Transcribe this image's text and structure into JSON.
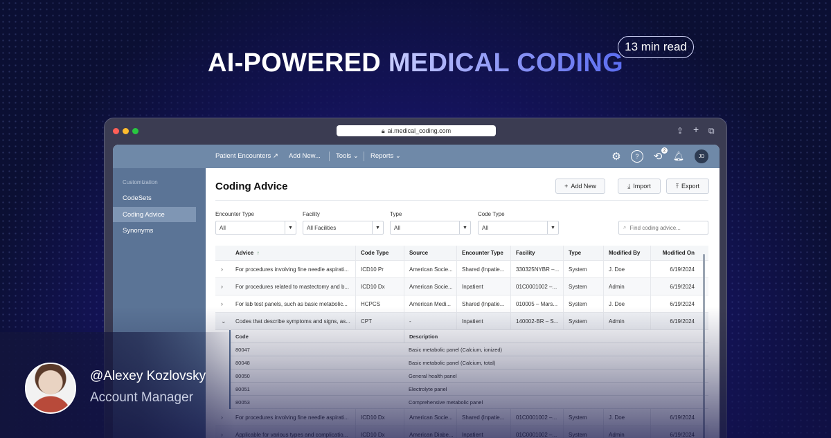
{
  "headline": {
    "part1": "AI-POWERED",
    "part2": "MEDICAL CODING"
  },
  "read_time": "13 min read",
  "browser": {
    "url": "ai.medical_coding.com"
  },
  "nav": {
    "items": [
      "Patient Encounters",
      "Add New...",
      "Tools",
      "Reports"
    ],
    "history_badge": "2",
    "avatar_initials": "JD"
  },
  "sidebar": {
    "heading": "Customization",
    "items": [
      "CodeSets",
      "Coding Advice",
      "Synonyms"
    ],
    "active": "Coding Advice"
  },
  "page": {
    "title": "Coding Advice",
    "buttons": {
      "add": "Add New",
      "import": "Import",
      "export": "Export"
    }
  },
  "filters": [
    {
      "label": "Encounter Type",
      "value": "All"
    },
    {
      "label": "Facility",
      "value": "All Facilities"
    },
    {
      "label": "Type",
      "value": "All"
    },
    {
      "label": "Code Type",
      "value": "All"
    }
  ],
  "search": {
    "placeholder": "Find coding advice..."
  },
  "table": {
    "columns": [
      "Advice",
      "Code Type",
      "Source",
      "Encounter Type",
      "Facility",
      "Type",
      "Modified By",
      "Modified On"
    ],
    "sort_indicator": "↑",
    "rows": [
      [
        "For procedures involving fine needle aspirati...",
        "ICD10 Pr",
        "American Socie...",
        "Shared (Inpatie...",
        "330325NYBR –...",
        "System",
        "J. Doe",
        "6/19/2024"
      ],
      [
        "For procedures related to mastectomy and b...",
        "ICD10 Dx",
        "American Socie...",
        "Inpatient",
        "01C0001002 –...",
        "System",
        "Admin",
        "6/19/2024"
      ],
      [
        "For lab test panels, such as basic metabolic...",
        "HCPCS",
        "American Medi...",
        "Shared (Inpatie...",
        "010005 – Mars...",
        "System",
        "J. Doe",
        "6/19/2024"
      ],
      [
        "Codes that describe symptoms and signs, as...",
        "CPT",
        "-",
        "Inpatient",
        "140002-BR – S...",
        "System",
        "Admin",
        "6/19/2024"
      ]
    ],
    "rows_after": [
      [
        "For procedures involving fine needle aspirati...",
        "ICD10 Dx",
        "American Socie...",
        "Shared (Inpatie...",
        "01C0001002 –...",
        "System",
        "J. Doe",
        "6/19/2024"
      ],
      [
        "Applicable for various types and complicatio...",
        "ICD10 Dx",
        "American Diabe...",
        "Inpatient",
        "01C0001002 –...",
        "System",
        "Admin",
        "6/19/2024"
      ]
    ]
  },
  "subtable": {
    "columns": [
      "Code",
      "Description"
    ],
    "rows": [
      [
        "80047",
        "Basic metabolic panel (Calcium, ionized)"
      ],
      [
        "80048",
        "Basic metabolic panel (Calcium, total)"
      ],
      [
        "80050",
        "General health panel"
      ],
      [
        "80051",
        "Electrolyte panel"
      ],
      [
        "80053",
        "Comprehensive metabolic panel"
      ]
    ]
  },
  "author": {
    "name": "@Alexey Kozlovsky",
    "role": "Account Manager"
  },
  "colors": {
    "nav": "#6f89a8",
    "sidebar": "#5b7496",
    "accent": "#5b6df0"
  }
}
